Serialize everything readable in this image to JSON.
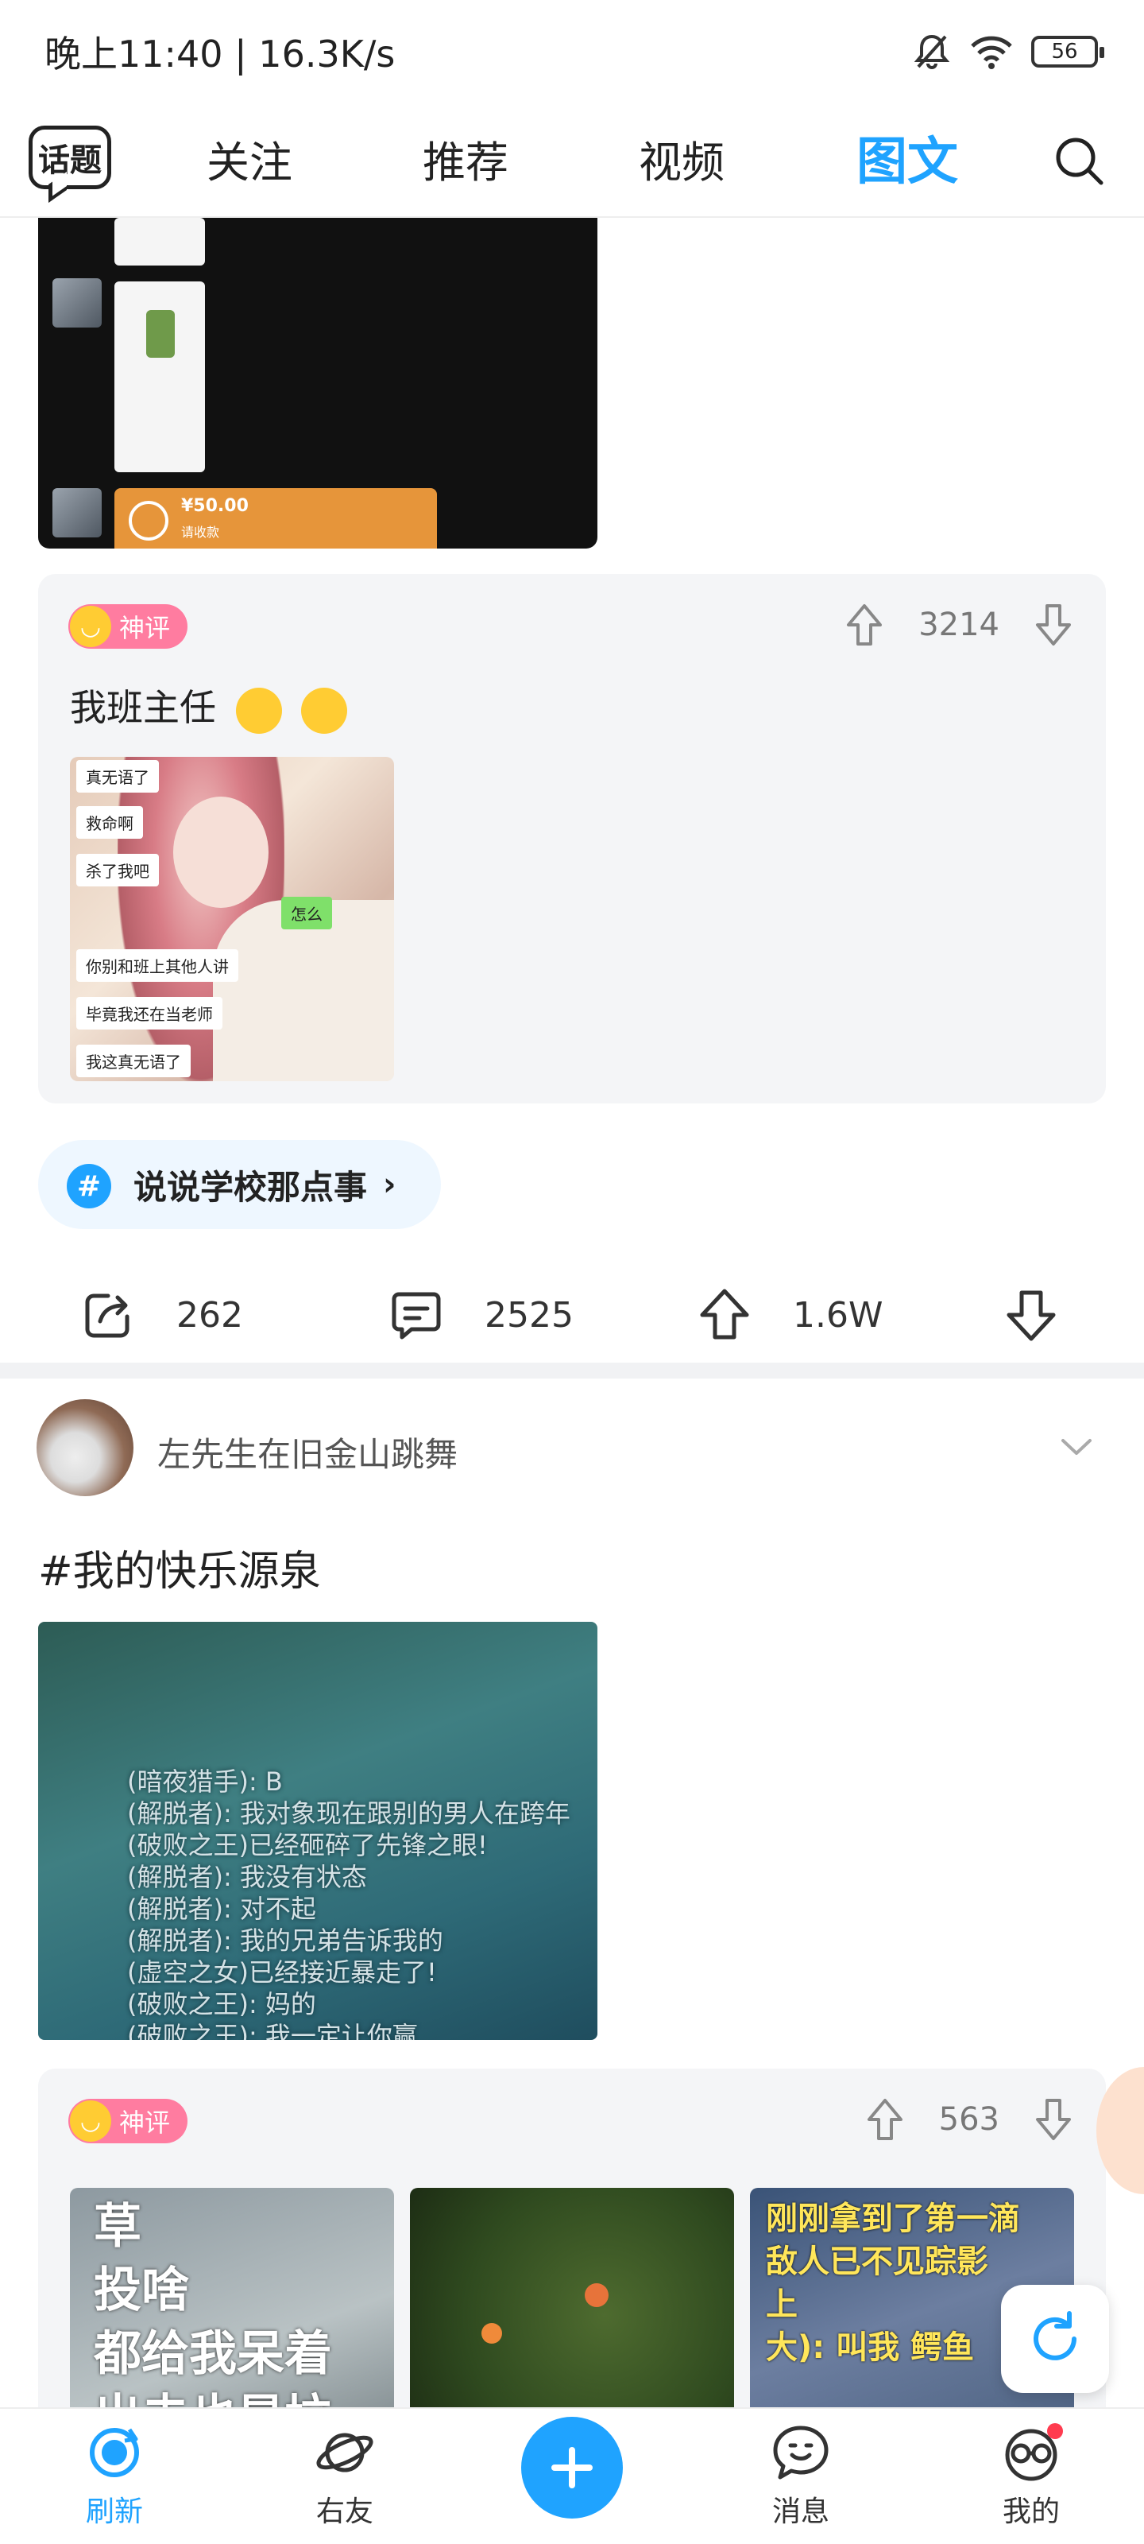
{
  "status_bar": {
    "time": "晚上11:40 | 16.3K/s",
    "battery": "56"
  },
  "top_nav": {
    "topic_button": "话题",
    "tabs": [
      {
        "label": "关注"
      },
      {
        "label": "推荐"
      },
      {
        "label": "视频"
      },
      {
        "label": "图文",
        "active": true
      }
    ],
    "search_icon": "search-icon"
  },
  "post1": {
    "payment_amount": "¥50.00",
    "payment_sub": "请收款",
    "god_comment": {
      "badge": "神评",
      "upvotes": "3214",
      "text": "我班主任",
      "image_bubbles": [
        "真无语了",
        "救命啊",
        "杀了我吧",
        "怎么",
        "你别和班上其他人讲",
        "毕竟我还在当老师",
        "我这真无语了"
      ]
    },
    "topic": "说说学校那点事",
    "actions": {
      "shares": "262",
      "comments": "2525",
      "likes": "1.6W"
    }
  },
  "post2": {
    "username": "左先生在旧金山跳舞",
    "title": "#我的快乐源泉",
    "image_lines": [
      "(暗夜猎手): B",
      "(解脱者): 我对象现在跟别的男人在跨年",
      "(破败之王)已经砸碎了先锋之眼!",
      "(解脱者): 我没有状态",
      "(解脱者): 对不起",
      "(解脱者): 我的兄弟告诉我的",
      "(虚空之女)已经接近暴走了!",
      "(破败之王): 妈的",
      "(破败之王): 我一定让你赢"
    ],
    "god_comment": {
      "badge": "神评",
      "upvotes": "563",
      "thumb1_lines": [
        "草",
        "投啥",
        "都给我呆着",
        "出去也是垃"
      ],
      "thumb3_lines": [
        "刚刚拿到了第一滴",
        "敌人已不见踪影",
        "上",
        "大): 叫我 鳄鱼"
      ]
    }
  },
  "bottom_bar": {
    "tabs": [
      {
        "label": "刷新",
        "active": true
      },
      {
        "label": "右友"
      },
      {
        "label": "消息"
      },
      {
        "label": "我的"
      }
    ]
  },
  "colors": {
    "accent": "#1fa3ff",
    "badge": "#ff7ca0",
    "notification": "#ff3b4f"
  }
}
